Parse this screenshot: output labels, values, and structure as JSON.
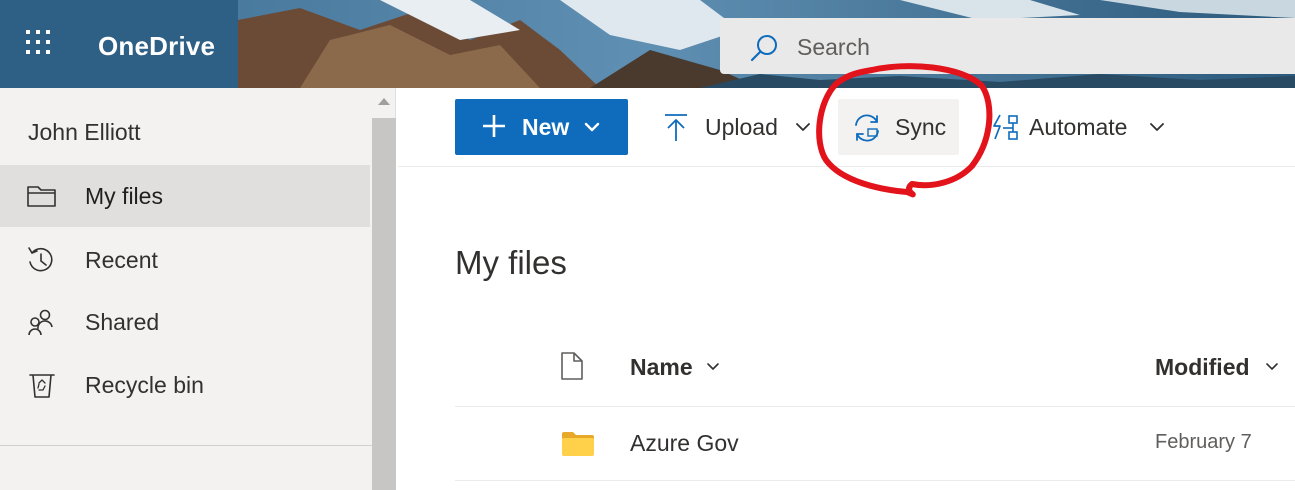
{
  "header": {
    "app_name": "OneDrive",
    "search_placeholder": "Search"
  },
  "sidebar": {
    "user_name": "John Elliott",
    "items": [
      {
        "label": "My files",
        "icon": "folder-icon",
        "active": true
      },
      {
        "label": "Recent",
        "icon": "history-icon",
        "active": false
      },
      {
        "label": "Shared",
        "icon": "shared-people-icon",
        "active": false
      },
      {
        "label": "Recycle bin",
        "icon": "recycle-bin-icon",
        "active": false
      }
    ]
  },
  "command_bar": {
    "new_label": "New",
    "upload_label": "Upload",
    "sync_label": "Sync",
    "automate_label": "Automate"
  },
  "main": {
    "title": "My files",
    "columns": {
      "name": "Name",
      "modified": "Modified"
    },
    "rows": [
      {
        "name": "Azure Gov",
        "modified": "February 7",
        "type": "folder"
      }
    ]
  },
  "colors": {
    "accent": "#0f6cbd",
    "brand_block": "#2e5f84",
    "annotation": "#e3131b",
    "folder": "#ffd04a"
  }
}
